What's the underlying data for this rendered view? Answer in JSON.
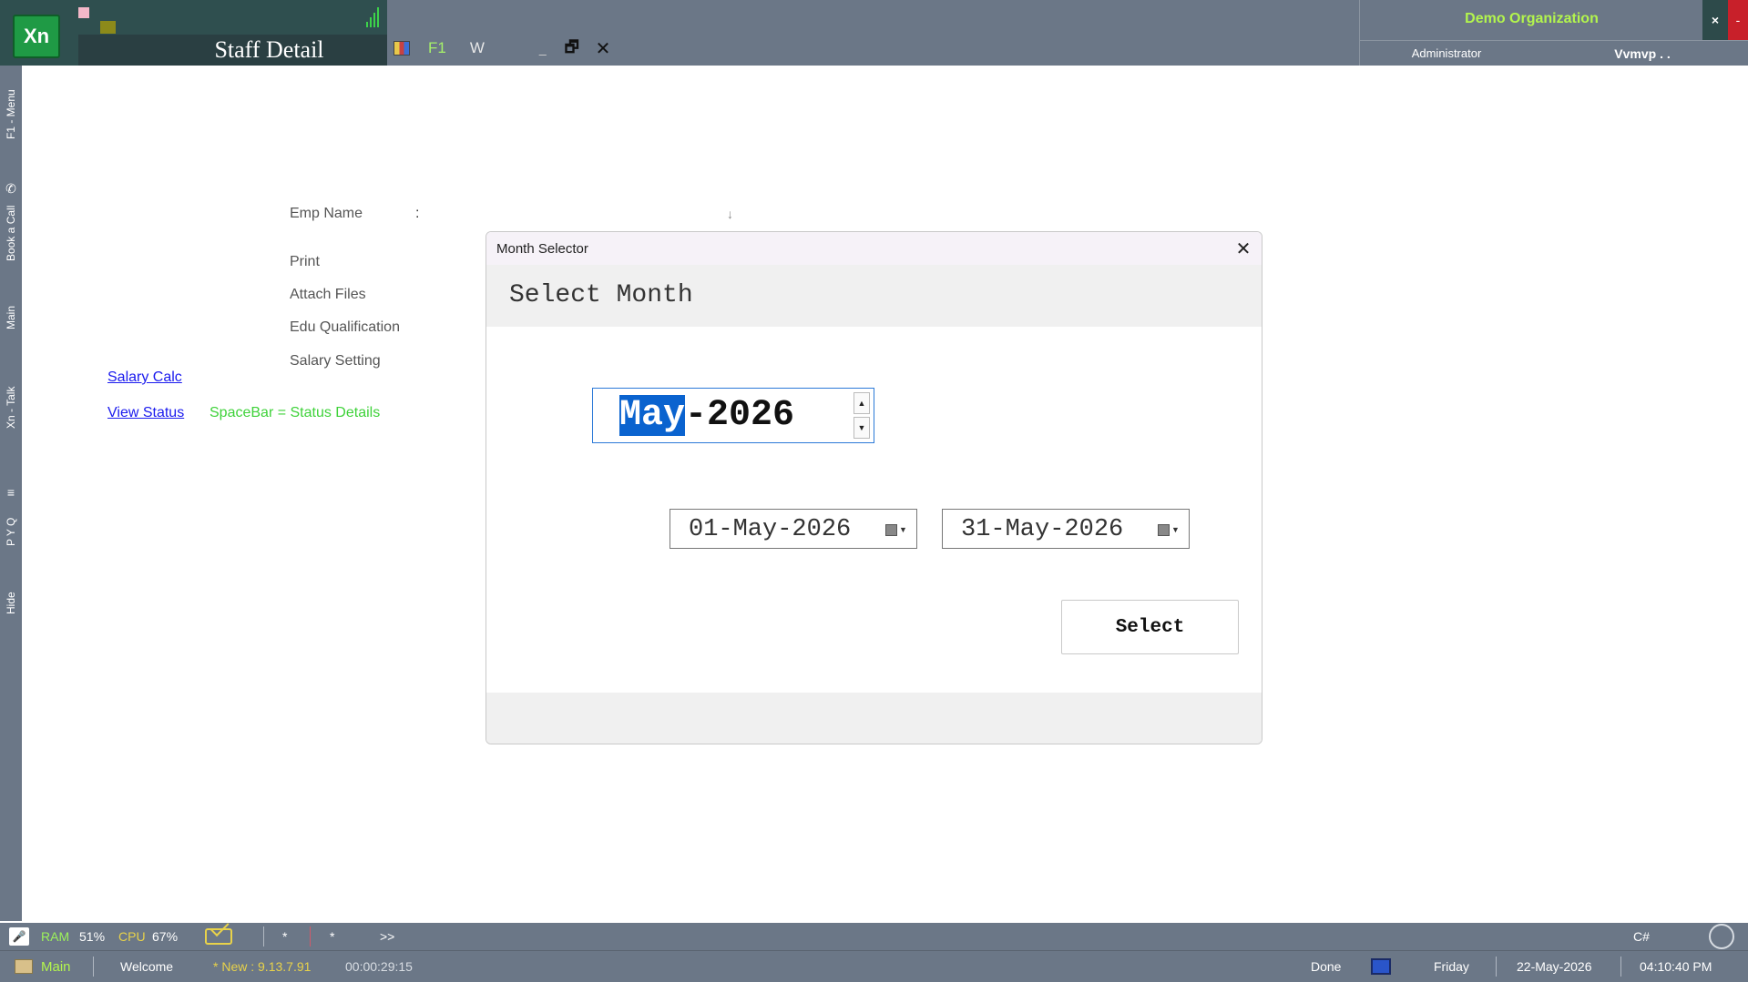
{
  "app": {
    "logo_text": "Xn",
    "window_title": "Staff Detail",
    "toolbar": {
      "f1": "F1",
      "w": "W",
      "minimize": "_",
      "restore": "🗗",
      "close": "✕"
    },
    "organization": "Demo Organization",
    "user_role": "Administrator",
    "org_code": "Vvmvp . .",
    "win_close": "×",
    "win_min": "-"
  },
  "sidebar": {
    "tabs": [
      "F1 - Menu",
      "Book a Call",
      "Main",
      "Xn - Talk",
      "P Y Q",
      "Hide"
    ]
  },
  "form": {
    "emp_name_label": "Emp Name",
    "colon": ":",
    "dropdown_arrow": "↓",
    "menu": [
      "Print",
      "Attach Files",
      "Edu Qualification",
      "Salary Setting"
    ],
    "salary_calc_link": "Salary Calc",
    "view_status_link": "View Status",
    "status_hint": "SpaceBar = Status Details"
  },
  "dialog": {
    "title": "Month Selector",
    "close_glyph": "✕",
    "heading": "Select Month",
    "month_selected_part": "May",
    "month_rest": "-2026",
    "spin_up": "▲",
    "spin_down": "▼",
    "from_date": "01-May-2026",
    "to_date": "31-May-2026",
    "select_button": "Select"
  },
  "statusbar": {
    "ram_label": "RAM",
    "ram_value": "51%",
    "cpu_label": "CPU",
    "cpu_value": "67%",
    "star1": "*",
    "star2": "*",
    "more": ">>",
    "lang": "C#",
    "main_tab": "Main",
    "welcome": "Welcome",
    "version": "* New : 9.13.7.91",
    "timer": "00:00:29:15",
    "done": "Done",
    "day": "Friday",
    "date": "22-May-2026",
    "time": "04:10:40 PM"
  },
  "colors": {
    "chrome": "#6b7787",
    "title_block": "#2f4f4f",
    "accent_green": "#b3f54d",
    "link_blue": "#1a1aee",
    "hint_green": "#3fd23a",
    "selection_blue": "#0a63cf"
  }
}
